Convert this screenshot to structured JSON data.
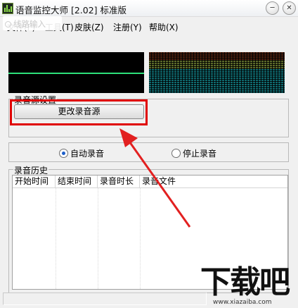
{
  "window": {
    "title": "语音监控大师 [2.02] 标准版",
    "minimize_glyph": "─",
    "close_glyph": "✕"
  },
  "menu": {
    "items": [
      "文件(F)",
      "工具(T)",
      "皮肤(Z)",
      "注册(Y)",
      "帮助(X)"
    ]
  },
  "overlay_radio": {
    "label": "线路输入"
  },
  "source_group": {
    "label": "录音源设置",
    "button_label": "更改录音源"
  },
  "record_mode": {
    "auto_label": "自动录音",
    "stop_label": "停止录音",
    "selected": "auto"
  },
  "history_group": {
    "label": "录音历史",
    "columns": [
      "开始时间",
      "结束时间",
      "录音时长",
      "录音文件"
    ],
    "rows": []
  },
  "watermark": {
    "logo": "下载吧",
    "url": "www.xiazaiba.com"
  },
  "colors": {
    "highlight": "#e00000",
    "scope_trace": "#2de07a",
    "scope_bg": "#000000"
  }
}
